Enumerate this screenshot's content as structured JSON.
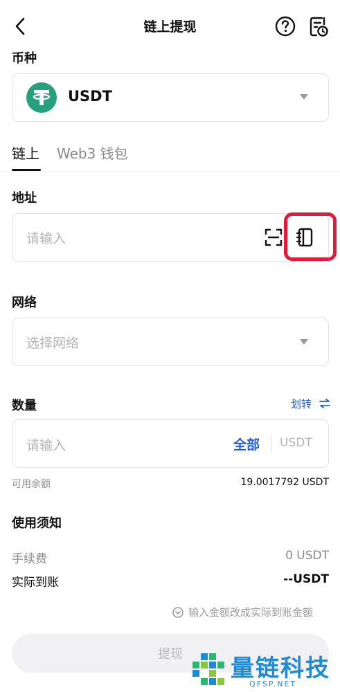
{
  "header": {
    "title": "链上提现"
  },
  "currency": {
    "label": "币种",
    "selected": "USDT",
    "coin_color": "#26a17b"
  },
  "tabs": [
    {
      "label": "链上",
      "active": true
    },
    {
      "label": "Web3 钱包",
      "active": false
    }
  ],
  "address": {
    "label": "地址",
    "placeholder": "请输入"
  },
  "network": {
    "label": "网络",
    "placeholder": "选择网络"
  },
  "quantity": {
    "label": "数量",
    "transfer_label": "划转",
    "placeholder": "请输入",
    "all_label": "全部",
    "unit": "USDT",
    "available_label": "可用余额",
    "available_value": "19.0017792 USDT"
  },
  "notice": {
    "title": "使用须知",
    "fee_label": "手续费",
    "fee_value": "0 USDT",
    "actual_label": "实际到账",
    "actual_value": "--USDT",
    "hint": "输入金额改成实际到账金额"
  },
  "submit": {
    "label": "提现"
  },
  "watermark": {
    "text": "量链科技",
    "sub": "QFSP.NET"
  },
  "colors": {
    "accent": "#1f5bd8",
    "highlight": "#e21b3c"
  }
}
